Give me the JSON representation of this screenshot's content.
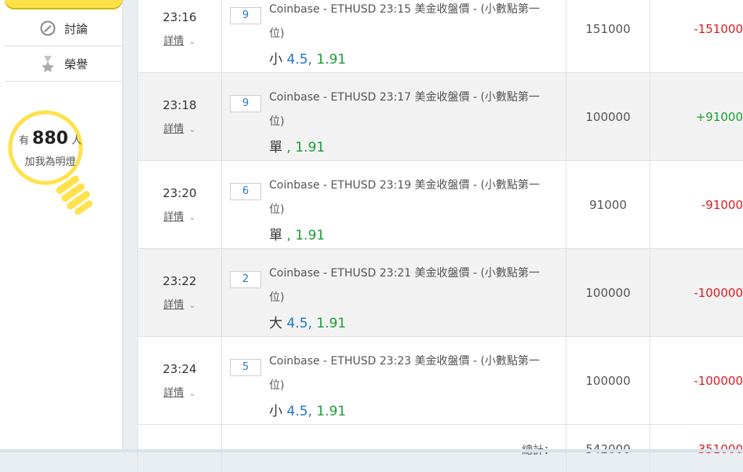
{
  "sidebar": {
    "items": [
      {
        "label": "討論",
        "icon": "discussion-icon"
      },
      {
        "label": "榮譽",
        "icon": "medal-icon"
      }
    ],
    "lamp": {
      "prefix": "有",
      "count": "880",
      "suffix": "人",
      "subtitle": "加我為明燈"
    }
  },
  "table": {
    "detail_label": "詳情",
    "rows": [
      {
        "time": "23:16",
        "qty": "9",
        "desc": "Coinbase - ETHUSD 23:15 美金收盤價 - (小數點第一位)",
        "pick": "小",
        "odds1": "4.5",
        "odds2": "1.91",
        "amount": "151000",
        "result": "-151000",
        "result_sign": "neg"
      },
      {
        "time": "23:18",
        "qty": "9",
        "desc": "Coinbase - ETHUSD 23:17 美金收盤價 - (小數點第一位)",
        "pick": "單",
        "odds1": "",
        "odds2": "1.91",
        "amount": "100000",
        "result": "+91000",
        "result_sign": "pos"
      },
      {
        "time": "23:20",
        "qty": "6",
        "desc": "Coinbase - ETHUSD 23:19 美金收盤價 - (小數點第一位)",
        "pick": "單",
        "odds1": "",
        "odds2": "1.91",
        "amount": "91000",
        "result": "-91000",
        "result_sign": "neg"
      },
      {
        "time": "23:22",
        "qty": "2",
        "desc": "Coinbase - ETHUSD 23:21 美金收盤價 - (小數點第一位)",
        "pick": "大",
        "odds1": "4.5",
        "odds2": "1.91",
        "amount": "100000",
        "result": "-100000",
        "result_sign": "neg"
      },
      {
        "time": "23:24",
        "qty": "5",
        "desc": "Coinbase - ETHUSD 23:23 美金收盤價 - (小數點第一位)",
        "pick": "小",
        "odds1": "4.5",
        "odds2": "1.91",
        "amount": "100000",
        "result": "-100000",
        "result_sign": "neg"
      }
    ],
    "total": {
      "label": "總計：",
      "amount": "542000",
      "result": "-351000"
    }
  },
  "colors": {
    "accent_yellow": "#ffe24a",
    "negative": "#e0191e",
    "positive": "#1b9e35",
    "odds_blue": "#1f77c7"
  }
}
